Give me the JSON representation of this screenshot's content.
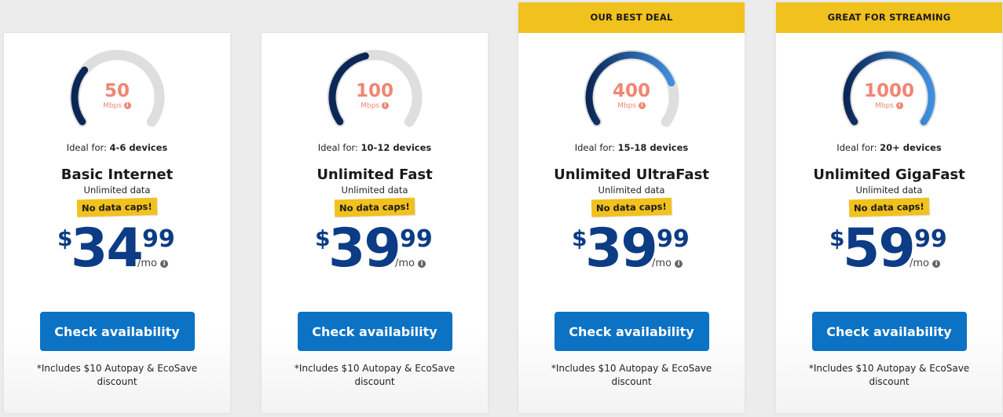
{
  "colors": {
    "accent_navy": "#0c3c85",
    "button_blue": "#0b72c4",
    "banner_yellow": "#f1c11d",
    "speed_salmon": "#f08673",
    "gauge_track": "#dedede",
    "gauge_dark": "#0b2756",
    "gauge_light": "#3f8fde"
  },
  "plans": [
    {
      "banner": null,
      "speed": "50",
      "speed_unit": "Mbps",
      "gauge_fill": 0.3,
      "ideal_label": "Ideal for:",
      "ideal_value": "4-6 devices",
      "name": "Basic Internet",
      "subtitle": "Unlimited data",
      "badge": "No data caps!",
      "price_symbol": "$",
      "price_dollars": "34",
      "price_cents": "99",
      "price_period": "/mo",
      "cta": "Check availability",
      "note": "*Includes $10 Autopay & EcoSave discount"
    },
    {
      "banner": null,
      "speed": "100",
      "speed_unit": "Mbps",
      "gauge_fill": 0.45,
      "ideal_label": "Ideal for:",
      "ideal_value": "10-12 devices",
      "name": "Unlimited Fast",
      "subtitle": "Unlimited data",
      "badge": "No data caps!",
      "price_symbol": "$",
      "price_dollars": "39",
      "price_cents": "99",
      "price_period": "/mo",
      "cta": "Check availability",
      "note": "*Includes $10 Autopay & EcoSave discount"
    },
    {
      "banner": "OUR BEST DEAL",
      "speed": "400",
      "speed_unit": "Mbps",
      "gauge_fill": 0.78,
      "ideal_label": "Ideal for:",
      "ideal_value": "15-18 devices",
      "name": "Unlimited UltraFast",
      "subtitle": "Unlimited data",
      "badge": "No data caps!",
      "price_symbol": "$",
      "price_dollars": "39",
      "price_cents": "99",
      "price_period": "/mo",
      "cta": "Check availability",
      "note": "*Includes $10 Autopay & EcoSave discount"
    },
    {
      "banner": "GREAT FOR STREAMING",
      "speed": "1000",
      "speed_unit": "Mbps",
      "gauge_fill": 1.0,
      "ideal_label": "Ideal for:",
      "ideal_value": "20+ devices",
      "name": "Unlimited GigaFast",
      "subtitle": "Unlimited data",
      "badge": "No data caps!",
      "price_symbol": "$",
      "price_dollars": "59",
      "price_cents": "99",
      "price_period": "/mo",
      "cta": "Check availability",
      "note": "*Includes $10 Autopay & EcoSave discount"
    }
  ]
}
